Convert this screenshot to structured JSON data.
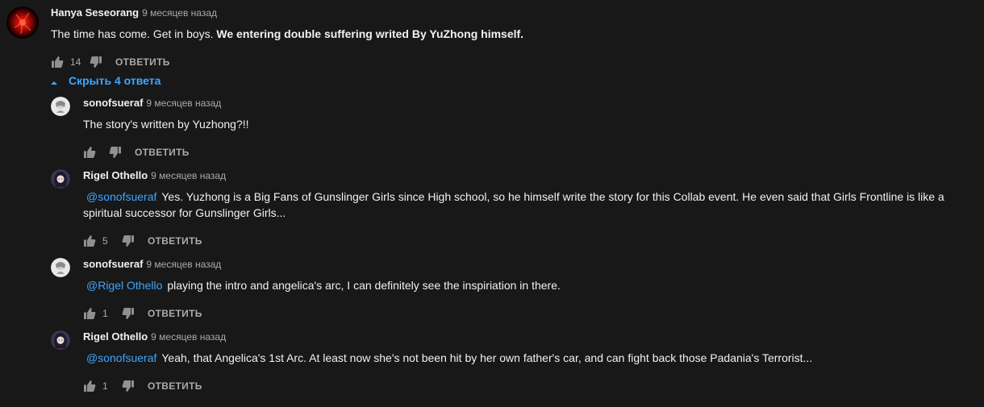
{
  "thread": {
    "top_comment": {
      "author": "Hanya Seseorang",
      "time": "9 месяцев назад",
      "text_plain": "The time has come. Get in boys. ",
      "text_bold": "We entering double suffering writed By YuZhong himself.",
      "likes": "14",
      "reply_label": "ОТВЕТИТЬ"
    },
    "toggle_replies_label": "Скрыть 4 ответа",
    "replies": [
      {
        "author": "sonofsueraf",
        "time": "9 месяцев назад",
        "mention": "",
        "text": "The story's written by Yuzhong?!!",
        "likes": "",
        "reply_label": "ОТВЕТИТЬ"
      },
      {
        "author": "Rigel Othello",
        "time": "9 месяцев назад",
        "mention": "@sonofsueraf",
        "text": "Yes. Yuzhong is a Big Fans of Gunslinger Girls since High school, so he himself write the story for this Collab event. He even said that Girls Frontline is like a spiritual successor for Gunslinger Girls...",
        "likes": "5",
        "reply_label": "ОТВЕТИТЬ"
      },
      {
        "author": "sonofsueraf",
        "time": "9 месяцев назад",
        "mention": "@Rigel Othello",
        "text": "playing the intro and angelica's arc, I can definitely see the inspiriation in there.",
        "likes": "1",
        "reply_label": "ОТВЕТИТЬ"
      },
      {
        "author": "Rigel Othello",
        "time": "9 месяцев назад",
        "mention": "@sonofsueraf",
        "text": "Yeah, that Angelica's 1st Arc. At least now she's not been hit by her own father's car, and can fight back those Padania's Terrorist...",
        "likes": "1",
        "reply_label": "ОТВЕТИТЬ"
      }
    ]
  },
  "colors": {
    "background": "#181818",
    "text_primary": "#f1f1f1",
    "text_secondary": "#aaaaaa",
    "link": "#3ea6ff"
  },
  "icons": {
    "like": "thumb-up-icon",
    "dislike": "thumb-down-icon",
    "toggle": "caret-up-icon"
  }
}
